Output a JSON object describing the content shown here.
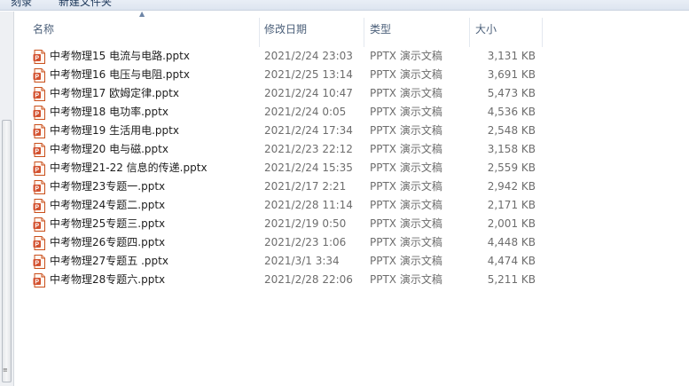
{
  "toolbar": {
    "burn_label": "刻录",
    "new_folder_label": "新建文件夹"
  },
  "columns": {
    "name": "名称",
    "date": "修改日期",
    "type": "类型",
    "size": "大小"
  },
  "files": [
    {
      "name": "中考物理15 电流与电路.pptx",
      "date": "2021/2/24 23:03",
      "type": "PPTX 演示文稿",
      "size": "3,131 KB"
    },
    {
      "name": "中考物理16 电压与电阻.pptx",
      "date": "2021/2/25 13:14",
      "type": "PPTX 演示文稿",
      "size": "3,691 KB"
    },
    {
      "name": "中考物理17 欧姆定律.pptx",
      "date": "2021/2/24 10:47",
      "type": "PPTX 演示文稿",
      "size": "5,473 KB"
    },
    {
      "name": "中考物理18 电功率.pptx",
      "date": "2021/2/24 0:05",
      "type": "PPTX 演示文稿",
      "size": "4,536 KB"
    },
    {
      "name": "中考物理19 生活用电.pptx",
      "date": "2021/2/24 17:34",
      "type": "PPTX 演示文稿",
      "size": "2,548 KB"
    },
    {
      "name": "中考物理20 电与磁.pptx",
      "date": "2021/2/23 22:12",
      "type": "PPTX 演示文稿",
      "size": "3,158 KB"
    },
    {
      "name": "中考物理21-22 信息的传递.pptx",
      "date": "2021/2/24 15:35",
      "type": "PPTX 演示文稿",
      "size": "2,559 KB"
    },
    {
      "name": "中考物理23专题一.pptx",
      "date": "2021/2/17 2:21",
      "type": "PPTX 演示文稿",
      "size": "2,942 KB"
    },
    {
      "name": "中考物理24专题二.pptx",
      "date": "2021/2/28 11:14",
      "type": "PPTX 演示文稿",
      "size": "2,171 KB"
    },
    {
      "name": "中考物理25专题三.pptx",
      "date": "2021/2/19 0:50",
      "type": "PPTX 演示文稿",
      "size": "2,001 KB"
    },
    {
      "name": "中考物理26专题四.pptx",
      "date": "2021/2/23 1:06",
      "type": "PPTX 演示文稿",
      "size": "4,448 KB"
    },
    {
      "name": "中考物理27专题五 .pptx",
      "date": "2021/3/1 3:34",
      "type": "PPTX 演示文稿",
      "size": "4,474 KB"
    },
    {
      "name": "中考物理28专题六.pptx",
      "date": "2021/2/28 22:06",
      "type": "PPTX 演示文稿",
      "size": "5,211 KB"
    }
  ],
  "icons": {
    "file": "powerpoint-file-icon",
    "sort": "sort-ascending-icon"
  },
  "colors": {
    "header_text": "#4c607a",
    "detail_text": "#6d6d6d",
    "ppt_orange": "#d35230"
  }
}
